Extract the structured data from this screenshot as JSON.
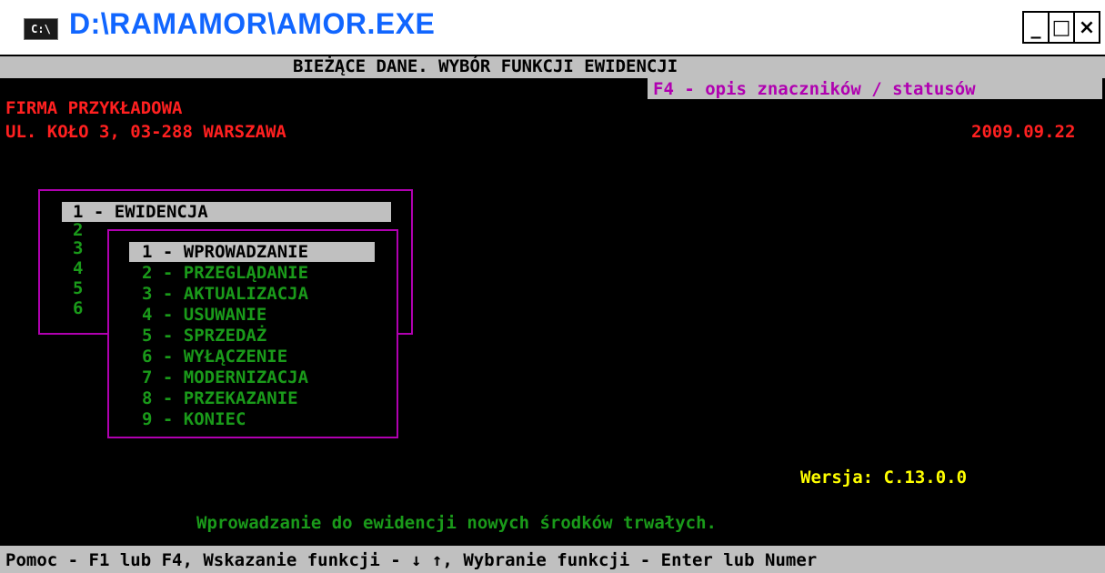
{
  "window": {
    "title": "D:\\RAMAMOR\\AMOR.EXE",
    "icon_label": "C:\\",
    "minimize": "_",
    "maximize": "□",
    "close": "×"
  },
  "header": {
    "title": "BIEŻĄCE DANE. WYBÓR FUNKCJI EWIDENCJI",
    "f4_hint": "F4 - opis znaczników / statusów"
  },
  "company": {
    "name": "FIRMA PRZYKŁADOWA",
    "address": "UL. KOŁO 3, 03-288 WARSZAWA",
    "date": "2009.09.22"
  },
  "outer_menu": {
    "selected": "1 - EWIDENCJA",
    "numbers": [
      "2",
      "3",
      "4",
      "5",
      "6"
    ]
  },
  "inner_menu": {
    "items": [
      "1 - WPROWADZANIE",
      "2 - PRZEGLĄDANIE",
      "3 - AKTUALIZACJA",
      "4 - USUWANIE",
      "5 - SPRZEDAŻ",
      "6 - WYŁĄCZENIE",
      "7 - MODERNIZACJA",
      "8 - PRZEKAZANIE",
      "9 - KONIEC"
    ],
    "selected_index": 0
  },
  "version": "Wersja: C.13.0.0",
  "hint": "Wprowadzanie do ewidencji nowych środków trwałych.",
  "footer": "Pomoc - F1 lub F4, Wskazanie funkcji - ↓ ↑, Wybranie funkcji - Enter lub Numer",
  "colors": {
    "menu_text": "#1a9a1a",
    "highlight_bar": "#c0c0c0",
    "box_border": "#b000b0",
    "firm_text": "#ff2020",
    "version_text": "#ffff00"
  }
}
